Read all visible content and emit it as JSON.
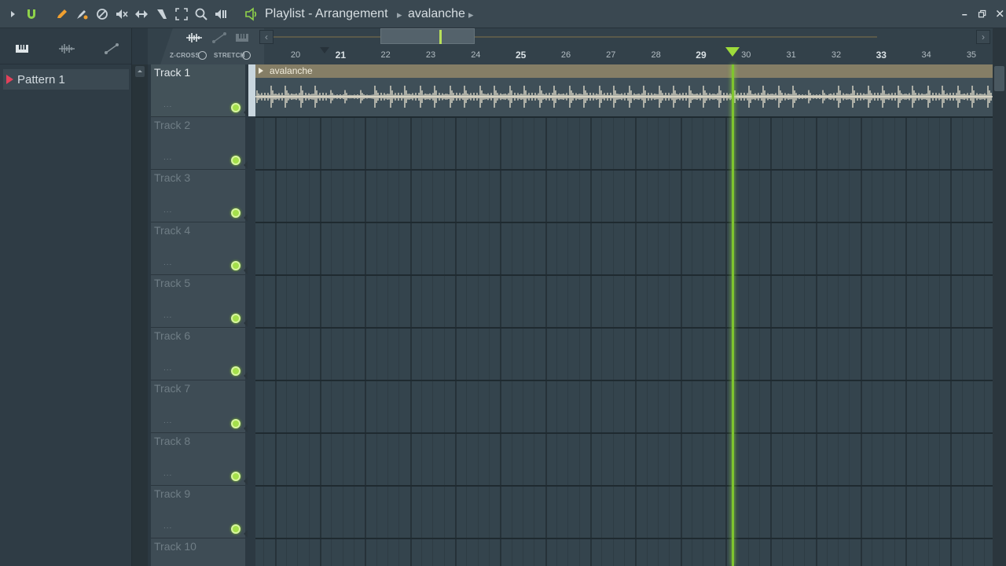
{
  "titlebar": {
    "title": "Playlist - Arrangement",
    "pattern": "avalanche"
  },
  "browser": {
    "patterns": [
      {
        "label": "Pattern 1"
      }
    ]
  },
  "toolbar2": {
    "zcross_label": "Z-CROSS",
    "stretch_label": "STRETCH"
  },
  "ruler": {
    "bars": [
      "20",
      "21",
      "22",
      "23",
      "24",
      "25",
      "26",
      "27",
      "28",
      "29",
      "30",
      "31",
      "32",
      "33",
      "34",
      "35"
    ],
    "big_bars": [
      "21",
      "25",
      "29",
      "33"
    ],
    "playhead_bar": 29.7
  },
  "tracks": [
    {
      "name": "Track 1",
      "dots": "..."
    },
    {
      "name": "Track 2",
      "dots": "..."
    },
    {
      "name": "Track 3",
      "dots": "..."
    },
    {
      "name": "Track 4",
      "dots": "..."
    },
    {
      "name": "Track 5",
      "dots": "..."
    },
    {
      "name": "Track 6",
      "dots": "..."
    },
    {
      "name": "Track 7",
      "dots": "..."
    },
    {
      "name": "Track 8",
      "dots": "..."
    },
    {
      "name": "Track 9",
      "dots": "..."
    },
    {
      "name": "Track 10",
      "dots": "..."
    }
  ],
  "clip": {
    "title": "avalanche"
  },
  "colors": {
    "accent": "#9fdc3b",
    "clip_header": "#857e66",
    "pattern_marker": "#e2415a"
  }
}
